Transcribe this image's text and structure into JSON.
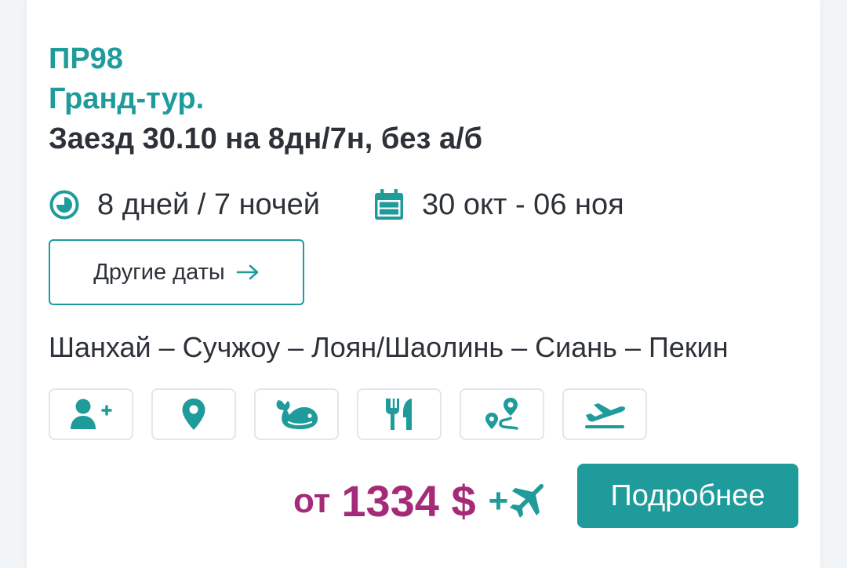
{
  "tour": {
    "code": "ПР98",
    "name": "Гранд-тур.",
    "subtitle": "Заезд 30.10 на 8дн/7н, без а/б",
    "duration": "8 дней / 7 ночей",
    "dates": "30 окт - 06 ноя",
    "other_dates_label": "Другие даты",
    "route": "Шанхай – Сучжоу – Лоян/Шаолинь – Сиань – Пекин"
  },
  "icons": {
    "duration": "clock-icon",
    "dates": "calendar-icon",
    "arrow": "arrow-right-icon",
    "features": [
      "add-person-icon",
      "location-pin-icon",
      "whale-icon",
      "fork-knife-icon",
      "route-icon",
      "plane-departure-icon"
    ],
    "flight": "airplane-icon"
  },
  "price": {
    "prefix": "от",
    "amount": "1334 $",
    "suffix": "+"
  },
  "details_button": "Подробнее",
  "colors": {
    "teal": "#1f9b9b",
    "price": "#a52a78",
    "text": "#2d3138"
  }
}
